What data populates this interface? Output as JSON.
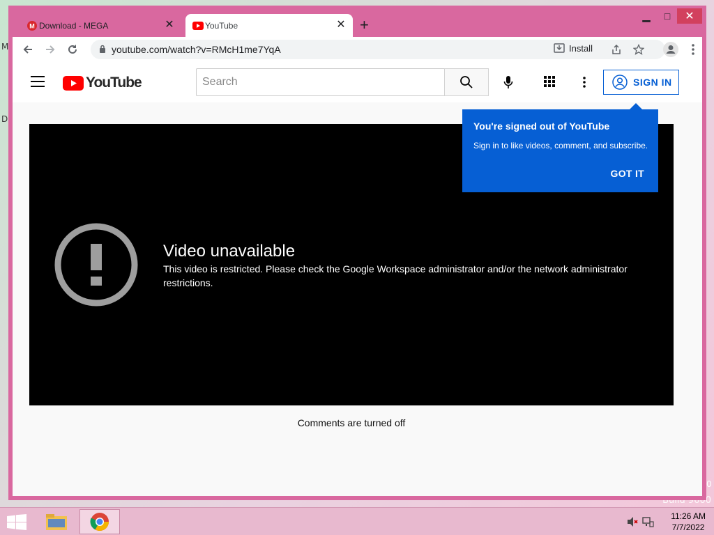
{
  "desktop": {
    "frag_left_1": "M",
    "frag_left_2": "D",
    "frag_right_1": "0",
    "build": "Build 9600"
  },
  "browser": {
    "tabs": [
      {
        "title": "Download - MEGA",
        "active": false,
        "icon": "mega-icon"
      },
      {
        "title": "YouTube",
        "active": true,
        "icon": "youtube-icon"
      }
    ],
    "new_tab": "+",
    "window_controls": {
      "minimize": "▁",
      "maximize": "□",
      "close": "✕"
    },
    "url": "youtube.com/watch?v=RMcH1me7YqA",
    "install_label": "Install"
  },
  "youtube": {
    "logo_text": "YouTube",
    "search_placeholder": "Search",
    "sign_in_label": "SIGN IN",
    "error_title": "Video unavailable",
    "error_message": "This video is restricted. Please check the Google Workspace administrator and/or the network administrator restrictions.",
    "comments_text": "Comments are turned off",
    "tooltip": {
      "title": "You're signed out of YouTube",
      "body": "Sign in to like videos, comment, and subscribe.",
      "button": "GOT IT"
    },
    "colors": {
      "brand_red": "#ff0000",
      "accent_blue": "#065fd4"
    }
  },
  "taskbar": {
    "time": "11:26 AM",
    "date": "7/7/2022"
  }
}
